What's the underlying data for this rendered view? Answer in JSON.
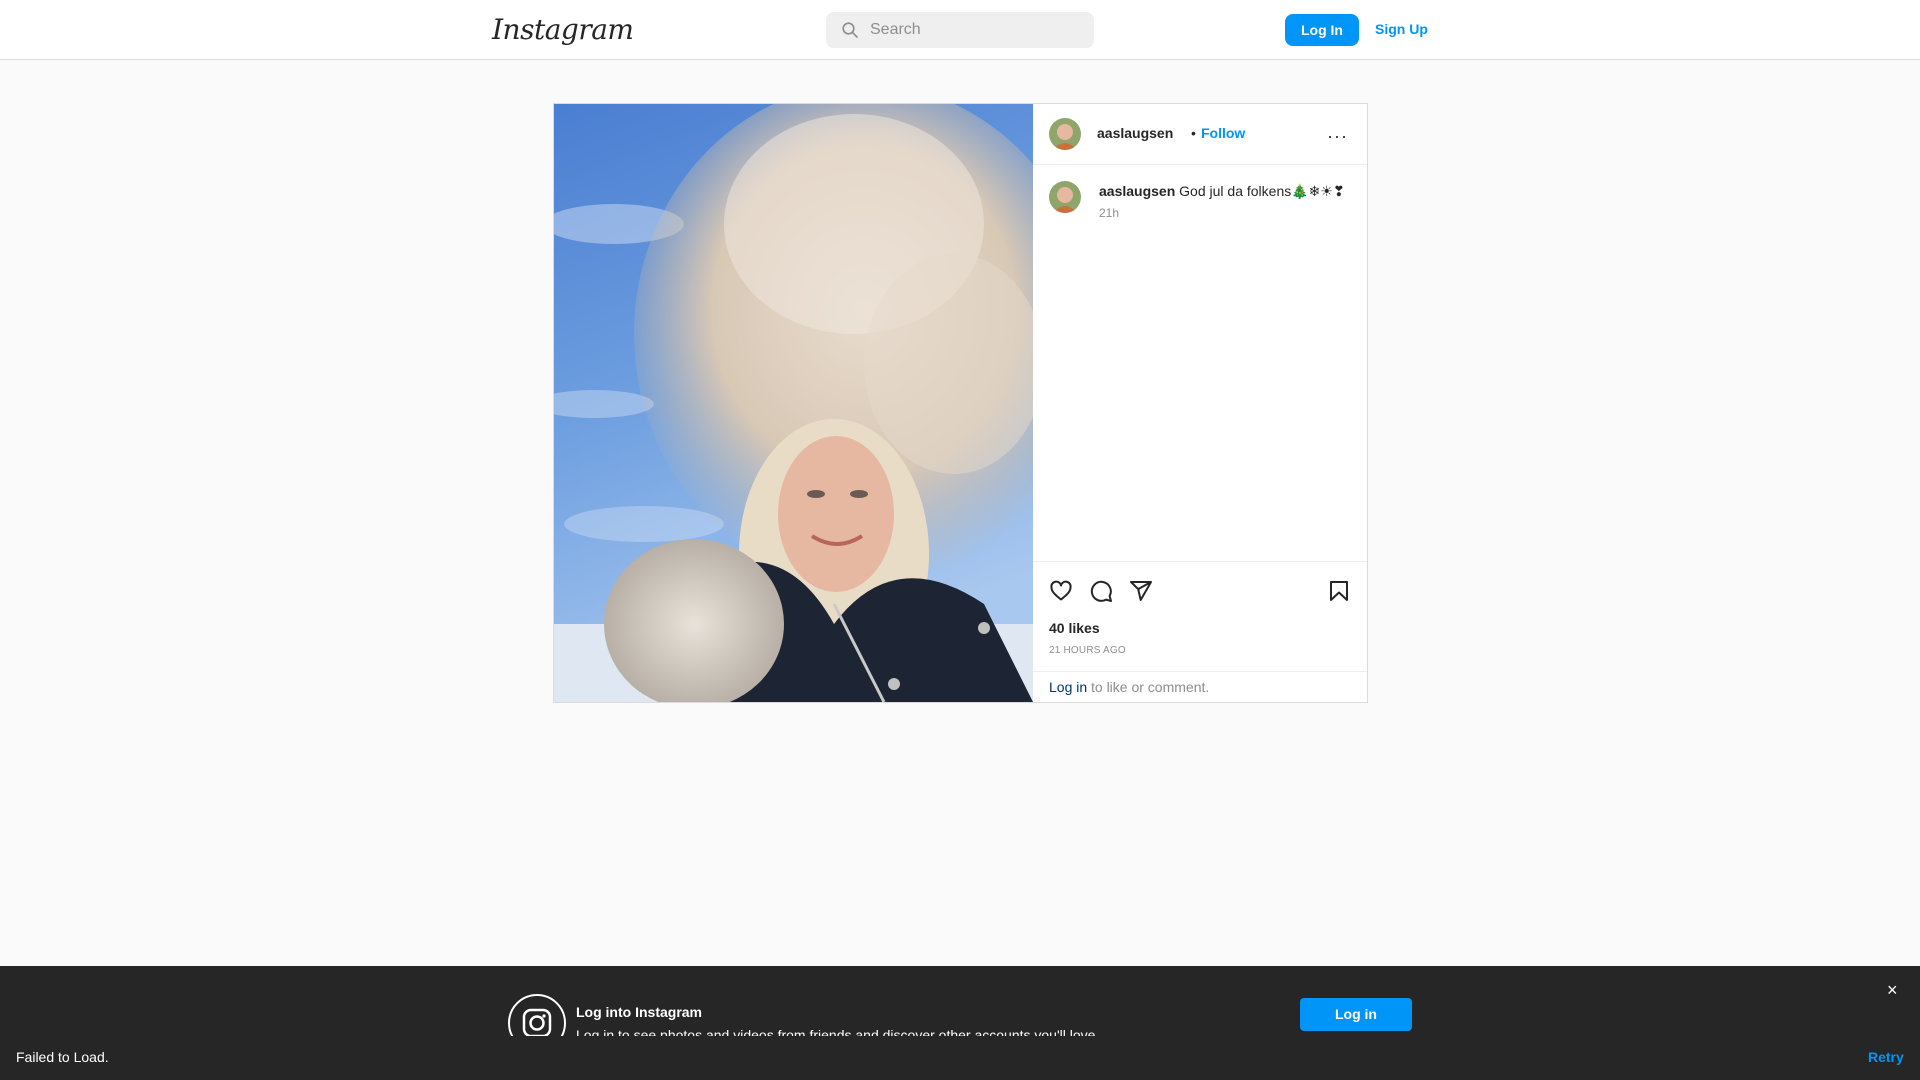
{
  "header": {
    "logo": "Instagram",
    "search_placeholder": "Search",
    "login_label": "Log In",
    "signup_label": "Sign Up"
  },
  "post": {
    "username": "aaslaugsen",
    "follow_label": "Follow",
    "separator": "•",
    "more_label": "···",
    "caption_user": "aaslaugsen",
    "caption_text": "God jul da folkens🎄❄☀❣",
    "caption_time": "21h",
    "likes": "40 likes",
    "posted_ago": "21 HOURS AGO",
    "login_link": "Log in",
    "login_rest": "to like or comment."
  },
  "banner": {
    "title": "Log into Instagram",
    "subtitle": "Log in to see photos and videos from friends and discover other accounts you'll love.",
    "button_label": "Log in",
    "close_label": "×"
  },
  "toast": {
    "message": "Failed to Load.",
    "retry_label": "Retry"
  },
  "colors": {
    "accent": "#0095f6",
    "text": "#262626",
    "muted": "#8e8e8e",
    "banner_bg": "#262626"
  },
  "icons": [
    "instagram-logo",
    "search-icon",
    "more-icon",
    "heart-icon",
    "comment-icon",
    "share-icon",
    "bookmark-icon",
    "close-icon",
    "instagram-camera-icon"
  ]
}
